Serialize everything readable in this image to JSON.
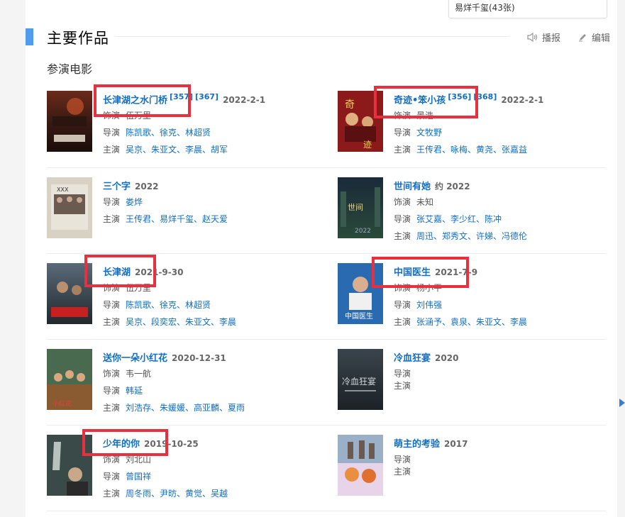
{
  "popup": {
    "text": "易烊千玺(43张)"
  },
  "section": {
    "title": "主要作品",
    "play_label": "播报",
    "edit_label": "编辑",
    "subtitle": "参演电影"
  },
  "movies": [
    {
      "title": "长津湖之水门桥",
      "ref1": "[357]",
      "ref2": "[367]",
      "date": "2022-2-1",
      "role_label": "饰演",
      "role": "伍万里",
      "director_label": "导演",
      "directors": "陈凯歌、徐克、林超贤",
      "cast_label": "主演",
      "cast": "吴京、朱亚文、李晨、胡军"
    },
    {
      "title": "奇迹•笨小孩",
      "ref1": "[356]",
      "ref2": "[368]",
      "date": "2022-2-1",
      "role_label": "饰演",
      "role": "景浩",
      "director_label": "导演",
      "directors": "文牧野",
      "cast_label": "主演",
      "cast": "王传君、咏梅、黄尧、张嘉益"
    },
    {
      "title": "三个字",
      "date": "2022",
      "director_label": "导演",
      "directors": "娄烨",
      "cast_label": "主演",
      "cast": "王传君、易烊千玺、赵天爱"
    },
    {
      "title": "世间有她",
      "date": "约 2022",
      "role_label": "饰演",
      "role": "未知",
      "director_label": "导演",
      "directors": "张艾嘉、李少红、陈冲",
      "cast_label": "主演",
      "cast": "周迅、郑秀文、许娣、冯德伦"
    },
    {
      "title": "长津湖",
      "date": "2021-9-30",
      "role_label": "饰演",
      "role": "伍万里",
      "director_label": "导演",
      "directors": "陈凯歌、徐克、林超贤",
      "cast_label": "主演",
      "cast": "吴京、段奕宏、朱亚文、李晨"
    },
    {
      "title": "中国医生",
      "date": "2021-7-9",
      "role_label": "饰演",
      "role": "杨小平",
      "director_label": "导演",
      "directors": "刘伟强",
      "cast_label": "主演",
      "cast": "张涵予、袁泉、朱亚文、李晨"
    },
    {
      "title": "送你一朵小红花",
      "date": "2020-12-31",
      "role_label": "饰演",
      "role": "韦一航",
      "director_label": "导演",
      "directors": "韩延",
      "cast_label": "主演",
      "cast": "刘浩存、朱媛媛、高亚麟、夏雨"
    },
    {
      "title": "冷血狂宴",
      "date": "2020",
      "director_label": "导演",
      "directors": "",
      "cast_label": "主演",
      "cast": ""
    },
    {
      "title": "少年的你",
      "date": "2019-10-25",
      "role_label": "饰演",
      "role": "刘北山",
      "director_label": "导演",
      "directors": "曾国祥",
      "cast_label": "主演",
      "cast": "周冬雨、尹昉、黄觉、吴越"
    },
    {
      "title": "萌主的考验",
      "date": "2017",
      "director_label": "导演",
      "directors": "",
      "cast_label": "主演",
      "cast": ""
    }
  ],
  "colors": {
    "link": "#136ec2",
    "accent": "#4f9cee",
    "highlight": "#e8303e"
  }
}
